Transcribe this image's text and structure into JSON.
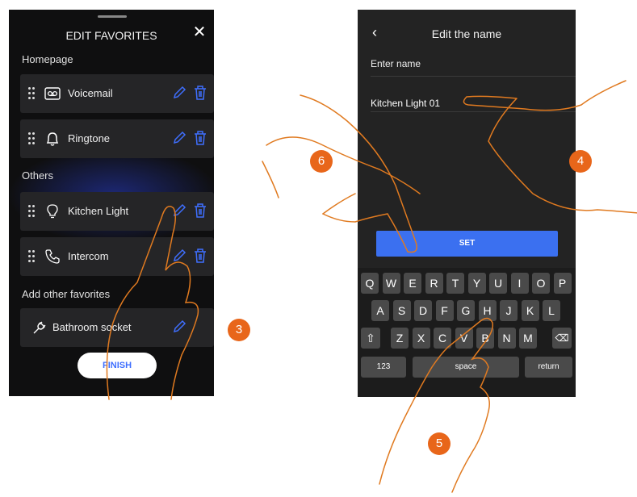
{
  "left_screen": {
    "title": "EDIT FAVORITES",
    "close_icon": "close-icon",
    "sections": [
      "Homepage",
      "Others",
      "Add other favorites"
    ],
    "homepage_items": [
      {
        "label": "Voicemail",
        "icon": "voicemail-icon"
      },
      {
        "label": "Ringtone",
        "icon": "bell-icon"
      }
    ],
    "others_items": [
      {
        "label": "Kitchen Light",
        "icon": "lightbulb-icon"
      },
      {
        "label": "Intercom",
        "icon": "phone-icon"
      }
    ],
    "add_items": [
      {
        "label": "Bathroom socket",
        "icon": "plug-icon"
      }
    ],
    "finish_label": "FINISH"
  },
  "right_screen": {
    "title": "Edit the name",
    "field_label": "Enter name",
    "field_value": "Kitchen Light  01",
    "set_label": "SET",
    "keyboard": {
      "row1": [
        "Q",
        "W",
        "E",
        "R",
        "T",
        "Y",
        "U",
        "I",
        "O",
        "P"
      ],
      "row2": [
        "A",
        "S",
        "D",
        "F",
        "G",
        "H",
        "J",
        "K",
        "L"
      ],
      "row3": [
        "Z",
        "X",
        "C",
        "V",
        "B",
        "N",
        "M"
      ],
      "numbers_label": "123",
      "space_label": "space",
      "return_label": "return"
    }
  },
  "step_badges": [
    "3",
    "4",
    "5",
    "6"
  ],
  "colors": {
    "accent": "#3b70f0",
    "badge": "#e8661a",
    "hand_line": "#e07a20"
  }
}
